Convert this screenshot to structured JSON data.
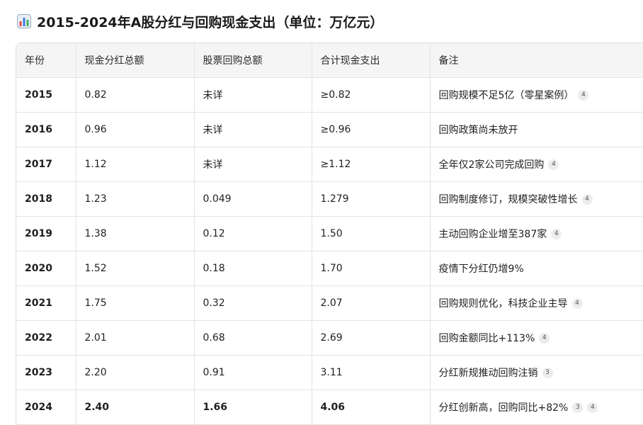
{
  "title": "2015-2024年A股分红与回购现金支出（单位：万亿元）",
  "table": {
    "headers": [
      "年份",
      "现金分红总额",
      "股票回购总额",
      "合计现金支出",
      "备注"
    ],
    "rows": [
      {
        "year": "2015",
        "dividend": "0.82",
        "buyback": "未详",
        "total": "≥0.82",
        "note": "回购规模不足5亿（零星案例）",
        "refs": [
          "4"
        ]
      },
      {
        "year": "2016",
        "dividend": "0.96",
        "buyback": "未详",
        "total": "≥0.96",
        "note": "回购政策尚未放开",
        "refs": []
      },
      {
        "year": "2017",
        "dividend": "1.12",
        "buyback": "未详",
        "total": "≥1.12",
        "note": "全年仅2家公司完成回购",
        "refs": [
          "4"
        ]
      },
      {
        "year": "2018",
        "dividend": "1.23",
        "buyback": "0.049",
        "total": "1.279",
        "note": "回购制度修订，规模突破性增长",
        "refs": [
          "4"
        ]
      },
      {
        "year": "2019",
        "dividend": "1.38",
        "buyback": "0.12",
        "total": "1.50",
        "note": "主动回购企业增至387家",
        "refs": [
          "4"
        ]
      },
      {
        "year": "2020",
        "dividend": "1.52",
        "buyback": "0.18",
        "total": "1.70",
        "note": "疫情下分红仍增9%",
        "refs": []
      },
      {
        "year": "2021",
        "dividend": "1.75",
        "buyback": "0.32",
        "total": "2.07",
        "note": "回购规则优化，科技企业主导",
        "refs": [
          "4"
        ]
      },
      {
        "year": "2022",
        "dividend": "2.01",
        "buyback": "0.68",
        "total": "2.69",
        "note": "回购金额同比+113%",
        "refs": [
          "4"
        ]
      },
      {
        "year": "2023",
        "dividend": "2.20",
        "buyback": "0.91",
        "total": "3.11",
        "note": "分红新规推动回购注销",
        "refs": [
          "3"
        ]
      },
      {
        "year": "2024",
        "dividend": "2.40",
        "buyback": "1.66",
        "total": "4.06",
        "note": "分红创新高，回购同比+82%",
        "refs": [
          "3",
          "4"
        ],
        "bold": true
      }
    ]
  },
  "colors": {
    "header_bg": "#f5f5f5",
    "border": "#e3e3e3",
    "badge_bg": "#ececec"
  },
  "icons": {
    "title_icon": "bar-chart-icon"
  }
}
